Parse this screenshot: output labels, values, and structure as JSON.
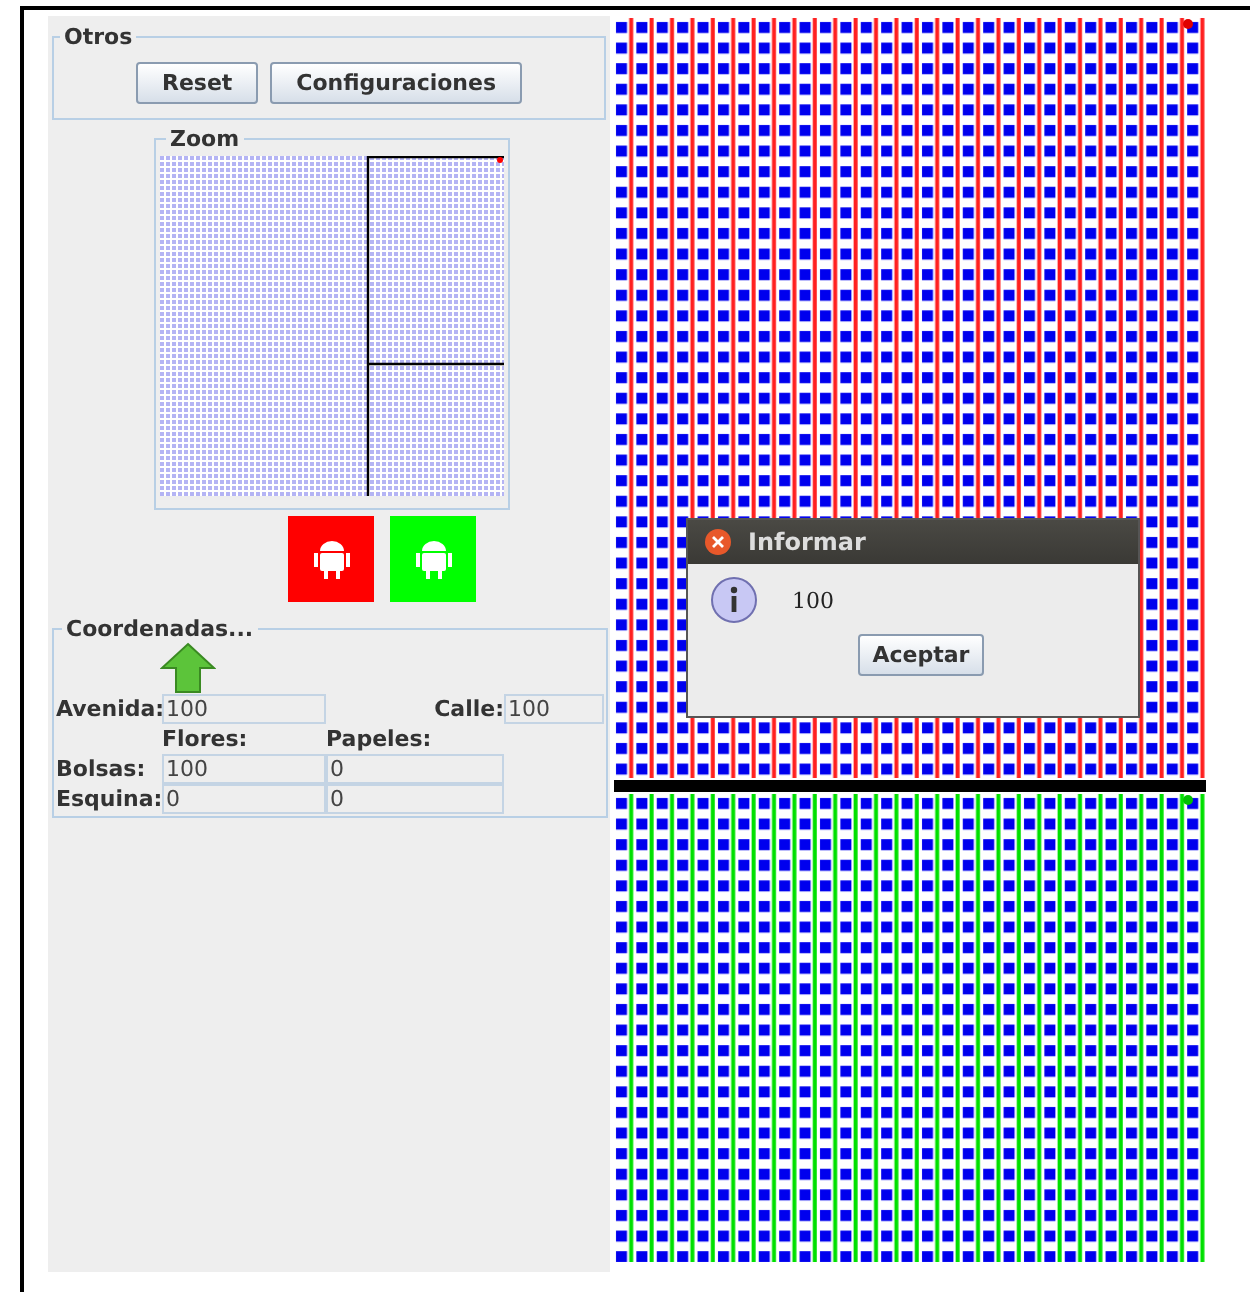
{
  "otros": {
    "legend": "Otros",
    "buttons": [
      "Reset",
      "Configuraciones"
    ]
  },
  "zoom": {
    "legend": "Zoom"
  },
  "robots": [
    {
      "color": "#ff0000"
    },
    {
      "color": "#00ff00"
    }
  ],
  "coordenadas": {
    "legend": "Coordenadas...",
    "avenida_label": "Avenida:",
    "avenida": "100",
    "calle_label": "Calle:",
    "calle": "100",
    "columns": [
      "Flores:",
      "Papeles:"
    ],
    "rows": [
      {
        "label": "Bolsas:",
        "values": [
          "100",
          "0"
        ]
      },
      {
        "label": "Esquina:",
        "values": [
          "0",
          "0"
        ]
      }
    ]
  },
  "dialog": {
    "title": "Informar",
    "message": "100",
    "button": "Aceptar"
  }
}
